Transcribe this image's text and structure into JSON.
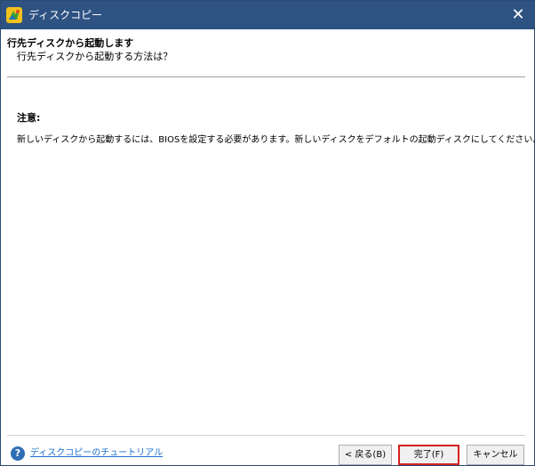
{
  "window": {
    "title": "ディスクコピー",
    "close_label": "✕"
  },
  "header": {
    "title": "行先ディスクから起動します",
    "subtitle": "行先ディスクから起動する方法は？"
  },
  "content": {
    "notice_label": "注意:",
    "notice_text": "新しいディスクから起動するには、BIOSを設定する必要があります。新しいディスクをデフォルトの起動ディスクにしてください。"
  },
  "footer": {
    "help_icon_glyph": "?",
    "tutorial_link": "ディスクコピーのチュートリアル",
    "back_label": "< 戻る(B)",
    "finish_label": "完了(F)",
    "cancel_label": "キャンセル"
  },
  "colors": {
    "titlebar": "#2e5282",
    "highlight_border": "#d42020",
    "link": "#1a6fd0"
  }
}
